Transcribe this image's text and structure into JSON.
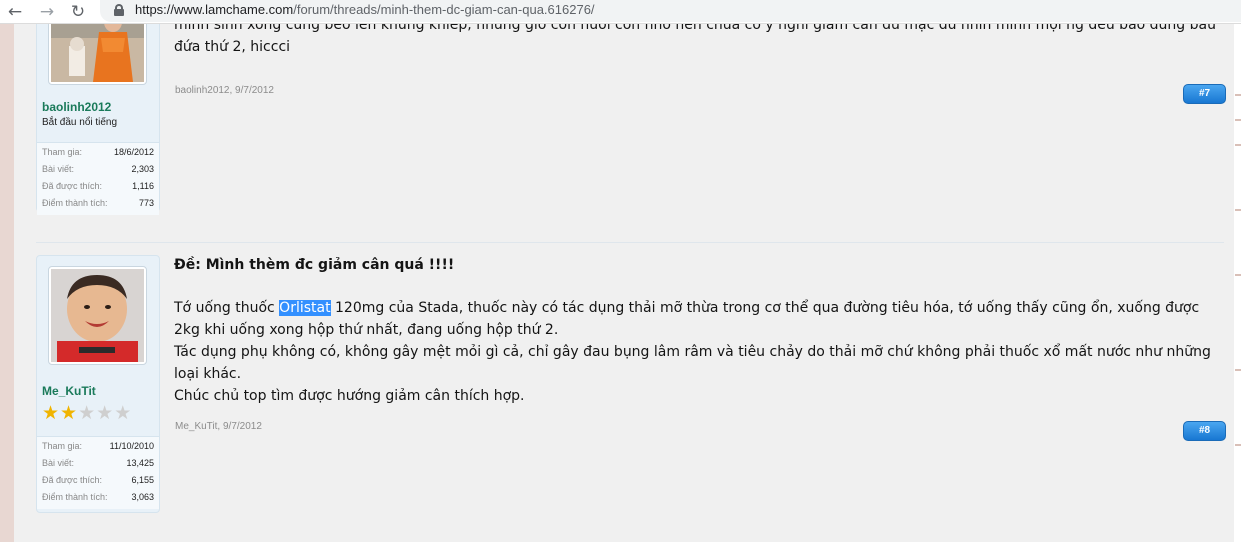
{
  "browser": {
    "url_host": "https://www.lamchame.com",
    "url_path": "/forum/threads/minh-them-dc-giam-can-qua.616276/"
  },
  "posts": [
    {
      "username": "baolinh2012",
      "user_title": "Bắt đầu nổi tiếng",
      "stats": [
        {
          "label": "Tham gia:",
          "value": "18/6/2012"
        },
        {
          "label": "Bài viết:",
          "value": "2,303"
        },
        {
          "label": "Đã được thích:",
          "value": "1,116"
        },
        {
          "label": "Điểm thành tích:",
          "value": "773"
        }
      ],
      "body_top_line": "mình sinh xong cũng béo lên khủng khiếp, nhưng giờ còn nuôi con nhỏ nên chưa có ý nghĩ giảm cân dù mặc dù nhìn mình mọi ng đều bảo đúng bầu",
      "body_line": "đứa thứ 2, hiccci",
      "meta": "baolinh2012, 9/7/2012",
      "post_number": "#7"
    },
    {
      "username": "Me_KuTit",
      "rating": {
        "filled": 2,
        "total": 5
      },
      "stats": [
        {
          "label": "Tham gia:",
          "value": "11/10/2010"
        },
        {
          "label": "Bài viết:",
          "value": "13,425"
        },
        {
          "label": "Đã được thích:",
          "value": "6,155"
        },
        {
          "label": "Điểm thành tích:",
          "value": "3,063"
        }
      ],
      "title": "Đề: Mình thèm đc giảm cân quá !!!!",
      "body_pre": "Tớ uống thuốc ",
      "body_highlight": "Orlistat",
      "body_post": " 120mg của Stada, thuốc này có tác dụng thải mỡ thừa trong cơ thể qua đường tiêu hóa, tớ uống thấy cũng ổn, xuống được 2kg khi uống xong hộp thứ nhất, đang uống hộp thứ 2.",
      "body_para2": "Tác dụng phụ không có, không gây mệt mỏi gì cả, chỉ gây đau bụng lâm râm và tiêu chảy do thải mỡ chứ không phải thuốc xổ mất nước như những loại khác.",
      "body_para3": "Chúc chủ top tìm được hướng giảm cân thích hợp.",
      "meta": "Me_KuTit, 9/7/2012",
      "post_number": "#8"
    }
  ]
}
